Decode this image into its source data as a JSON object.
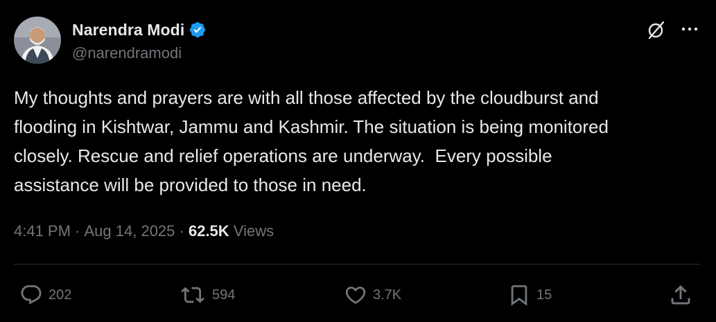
{
  "author": {
    "display_name": "Narendra Modi",
    "handle": "@narendramodi",
    "verified": true,
    "verified_color": "#1d9bf0"
  },
  "header_icons": {
    "grok": "grok-icon",
    "more": "more-icon"
  },
  "tweet": {
    "text": "My thoughts and prayers are with all those affected by the cloudburst and\nflooding in Kishtwar, Jammu and Kashmir. The situation is being monitored\nclosely. Rescue and relief operations are underway.  Every possible\nassistance will be provided to those in need."
  },
  "meta": {
    "time": "4:41 PM",
    "separator": " · ",
    "date": "Aug 14, 2025",
    "views_count": "62.5K",
    "views_label": " Views"
  },
  "actions": {
    "replies": "202",
    "reposts": "594",
    "likes": "3.7K",
    "bookmarks": "15"
  },
  "colors": {
    "background": "#000000",
    "text_primary": "#e7e9ea",
    "text_secondary": "#71767b",
    "divider": "#2f3336"
  }
}
